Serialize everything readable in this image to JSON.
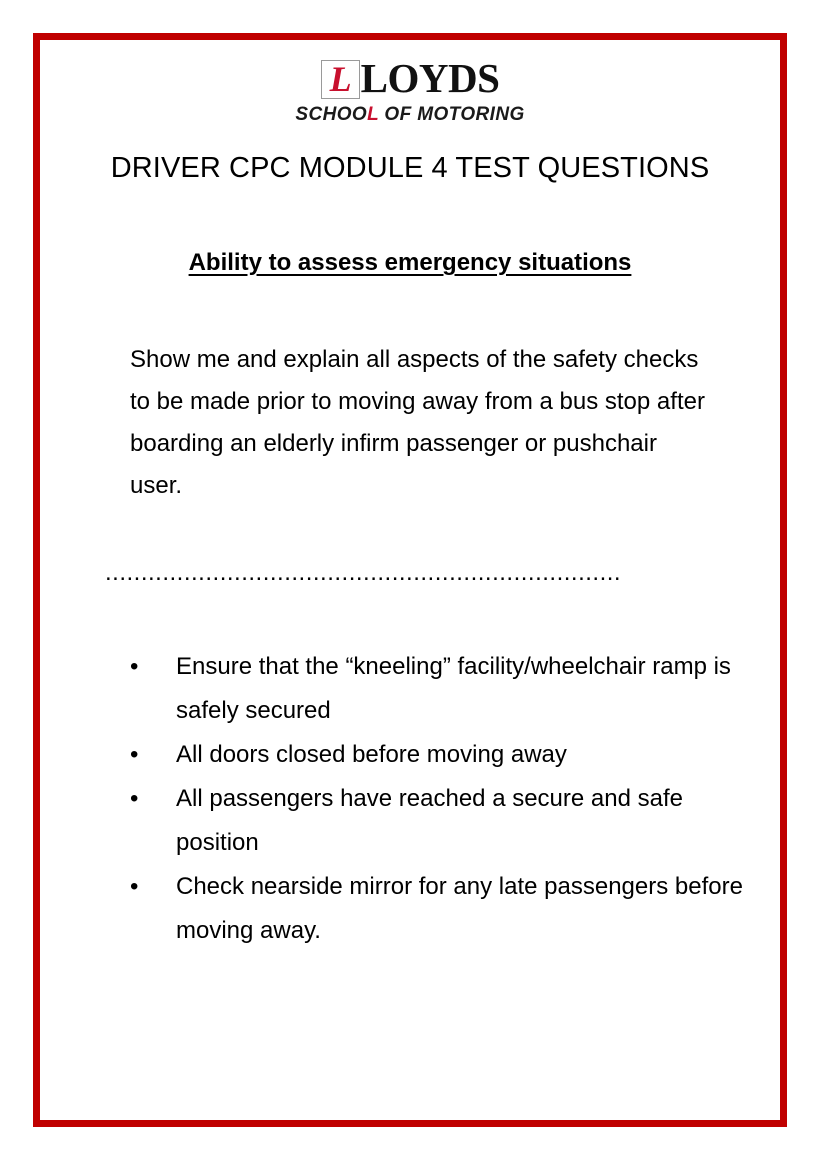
{
  "document": {
    "title": "DRIVER CPC MODULE 4 TEST QUESTIONS",
    "section_heading": "Ability to assess emergency situations",
    "question": "Show me and explain all aspects of the safety checks to be made prior to moving away from a bus stop after boarding an elderly infirm passenger or pushchair user.",
    "divider": "........................................................................",
    "answers": [
      "Ensure that the “kneeling” facility/wheelchair ramp is safely secured",
      "All doors closed before moving away",
      "All passengers have reached a secure and safe position",
      "Check nearside mirror for any late passengers before moving away."
    ],
    "bullet_glyph": "•"
  },
  "logo": {
    "plate_letter": "L",
    "wordmark": "LOYDS",
    "tagline_before": "SCHOO",
    "tagline_accent": "L",
    "tagline_after": " OF MOTORING"
  },
  "colors": {
    "border_red": "#C00000",
    "logo_red": "#C8102E",
    "text_black": "#000000"
  }
}
